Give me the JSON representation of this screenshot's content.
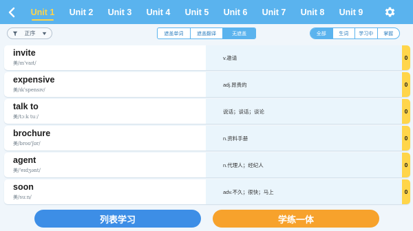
{
  "header": {
    "back_icon": "chevron-left-icon",
    "settings_icon": "gear-icon",
    "units": [
      "Unit 1",
      "Unit 2",
      "Unit 3",
      "Unit 4",
      "Unit 5",
      "Unit 6",
      "Unit 7",
      "Unit 8",
      "Unit 9"
    ],
    "active_unit": "Unit 1"
  },
  "filters": {
    "sort_icon": "filter-icon",
    "sort_label": "正序",
    "sort_arrow_icon": "caret-down-icon",
    "mode_tabs": [
      "遮盖单词",
      "遮盖翻译",
      "无遮盖"
    ],
    "mode_active": "无遮盖",
    "status_tabs": [
      "全部",
      "生词",
      "学习中",
      "掌握"
    ],
    "status_active": "全部"
  },
  "words": [
    {
      "word": "invite",
      "phonetic": "美/ɪn'vaɪt/",
      "meaning": "v.邀请",
      "count": "0"
    },
    {
      "word": "expensive",
      "phonetic": "美/ɪk'spensɪv/",
      "meaning": "adj.昂贵的",
      "count": "0"
    },
    {
      "word": "talk to",
      "phonetic": "美/tɔːk tuː/",
      "meaning": "说话；谈话；谈论",
      "count": "0"
    },
    {
      "word": "brochure",
      "phonetic": "美/broʊ'ʃʊr/",
      "meaning": "n.资料手册",
      "count": "0"
    },
    {
      "word": "agent",
      "phonetic": "美/'eɪdʒənt/",
      "meaning": "n.代理人；经纪人",
      "count": "0"
    },
    {
      "word": "soon",
      "phonetic": "美/suːn/",
      "meaning": "adv.不久；很快；马上",
      "count": "0"
    }
  ],
  "actions": {
    "list_study": "列表学习",
    "practice": "学练一体"
  },
  "colors": {
    "header_bg": "#5ab3ee",
    "active_unit": "#ffd54a",
    "count_badge": "#ffd54a",
    "list_button": "#3d8ee6",
    "practice_button": "#f7a22c"
  }
}
